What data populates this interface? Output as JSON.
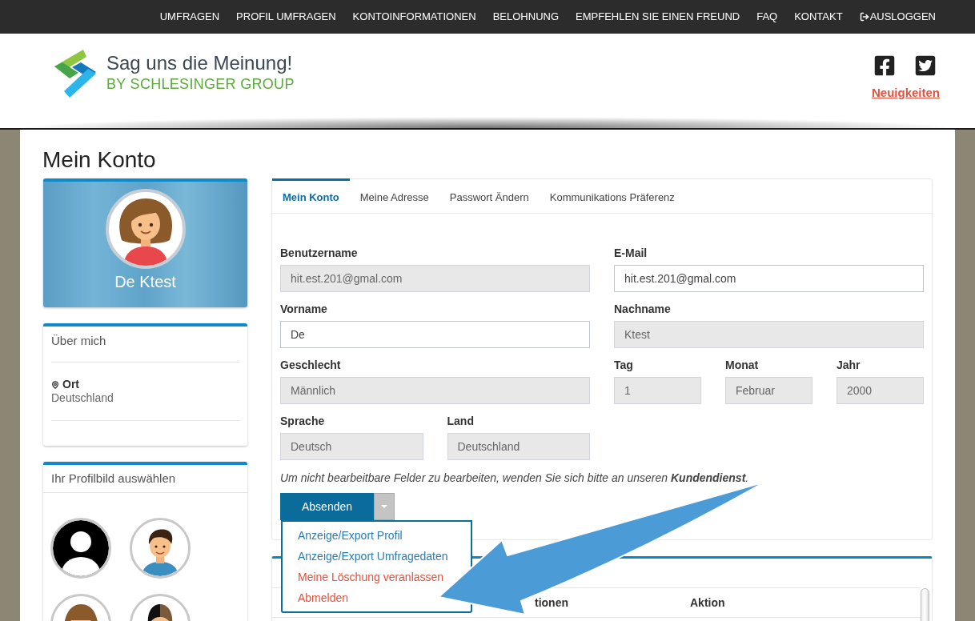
{
  "top_nav": {
    "items": [
      {
        "label": "UMFRAGEN",
        "kind": "link"
      },
      {
        "label": "PROFIL UMFRAGEN",
        "kind": "link"
      },
      {
        "label": "KONTOINFORMATIONEN",
        "kind": "link"
      },
      {
        "label": "BELOHNUNG",
        "kind": "link"
      },
      {
        "label": "EMPFEHLEN SIE EINEN FREUND",
        "kind": "link"
      },
      {
        "label": "FAQ",
        "kind": "link"
      },
      {
        "label": "KONTAKT",
        "kind": "link"
      },
      {
        "label": "AUSLOGGEN",
        "kind": "logout"
      }
    ]
  },
  "header": {
    "logo": {
      "title": "Sag uns die Meinung!",
      "subtitle": "BY SCHLESINGER GROUP"
    },
    "news_link": "Neuigkeiten"
  },
  "page_title": "Mein Konto",
  "profile_card": {
    "name": "De Ktest"
  },
  "about_card": {
    "title": "Über mich",
    "location_label": "Ort",
    "location_value": "Deutschland"
  },
  "avatar_picker": {
    "title": "Ihr Profilbild auswählen",
    "avatars": [
      {
        "kind": "silhouette"
      },
      {
        "kind": "boy"
      },
      {
        "kind": "girl"
      },
      {
        "kind": "boy_two_tone"
      }
    ]
  },
  "account_form": {
    "tabs": [
      {
        "label": "Mein Konto",
        "selected": true
      },
      {
        "label": "Meine Adresse",
        "selected": false
      },
      {
        "label": "Passwort Ändern",
        "selected": false
      },
      {
        "label": "Kommunikations Präferenz",
        "selected": false
      }
    ],
    "fields": [
      {
        "label": "Benutzername",
        "value": "hit.est.201@gmal.com",
        "disabled": true
      },
      {
        "label": "E-Mail",
        "value": "hit.est.201@gmal.com",
        "disabled": false
      },
      {
        "label": "Vorname",
        "value": "De",
        "disabled": false
      },
      {
        "label": "Nachname",
        "value": "Ktest",
        "disabled": true
      },
      {
        "label": "Geschlecht",
        "value": "Männlich",
        "disabled": true
      },
      {
        "label": "Tag",
        "value": "1",
        "disabled": true
      },
      {
        "label": "Monat",
        "value": "Februar",
        "disabled": true
      },
      {
        "label": "Jahr",
        "value": "2000",
        "disabled": true
      },
      {
        "label": "Sprache",
        "value": "Deutsch",
        "disabled": true
      },
      {
        "label": "Land",
        "value": "Deutschland",
        "disabled": true
      }
    ],
    "note": "Um nicht bearbeitbare Felder zu bearbeiten, wenden Sie sich bitte an unseren **Kundendienst**.",
    "submit_button": "Absenden",
    "dropdown": {
      "expanded": true,
      "items": [
        {
          "label": "Anzeige/Export Profil",
          "kind": "link"
        },
        {
          "label": "Anzeige/Export Umfragedaten",
          "kind": "link"
        },
        {
          "label": "Meine Löschung veranlassen",
          "kind": "danger"
        },
        {
          "label": "Abmelden",
          "kind": "danger"
        }
      ]
    }
  },
  "second_card": {
    "table": {
      "columns": [
        {
          "label": "tionen"
        },
        {
          "label": "Aktion"
        }
      ]
    }
  }
}
